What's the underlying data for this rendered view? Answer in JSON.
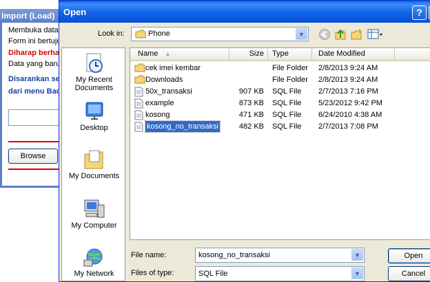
{
  "background_window": {
    "title": "Import (Load)",
    "lines": [
      "Membuka datab",
      "Form ini bertuju",
      "Diharap berha",
      "Data yang baru",
      "Disarankan se",
      "dari menu Bac"
    ],
    "browse_label": "Browse"
  },
  "dialog": {
    "title": "Open",
    "help_label": "?",
    "close_label": "X",
    "look_in_label": "Look in:",
    "look_in_value": "Phone",
    "places": [
      "My Recent Documents",
      "Desktop",
      "My Documents",
      "My Computer",
      "My Network"
    ],
    "columns": [
      "Name",
      "Size",
      "Type",
      "Date Modified"
    ],
    "files": [
      {
        "name": "cek imei kembar",
        "size": "",
        "type": "File Folder",
        "date": "2/8/2013 9:24 AM",
        "icon": "folder-icon"
      },
      {
        "name": "Downloads",
        "size": "",
        "type": "File Folder",
        "date": "2/8/2013 9:24 AM",
        "icon": "folder-icon"
      },
      {
        "name": "50x_transaksi",
        "size": "907 KB",
        "type": "SQL File",
        "date": "2/7/2013 7:16 PM",
        "icon": "sql-file-icon"
      },
      {
        "name": "example",
        "size": "873 KB",
        "type": "SQL File",
        "date": "5/23/2012 9:42 PM",
        "icon": "sql-file-icon"
      },
      {
        "name": "kosong",
        "size": "471 KB",
        "type": "SQL File",
        "date": "6/24/2010 4:38 AM",
        "icon": "sql-file-icon"
      },
      {
        "name": "kosong_no_transaksi",
        "size": "482 KB",
        "type": "SQL File",
        "date": "2/7/2013 7:08 PM",
        "icon": "sql-file-icon",
        "selected": true
      }
    ],
    "file_name_label": "File name:",
    "file_name_value": "kosong_no_transaksi",
    "file_type_label": "Files of type:",
    "file_type_value": "SQL File",
    "open_label": "Open",
    "cancel_label": "Cancel"
  },
  "colors": {
    "title_bar": "#0a5fd8",
    "dialog_bg": "#ece9d8",
    "selection": "#316ac5",
    "warning_text": "#e00000",
    "info_text": "#1c3fa8"
  }
}
